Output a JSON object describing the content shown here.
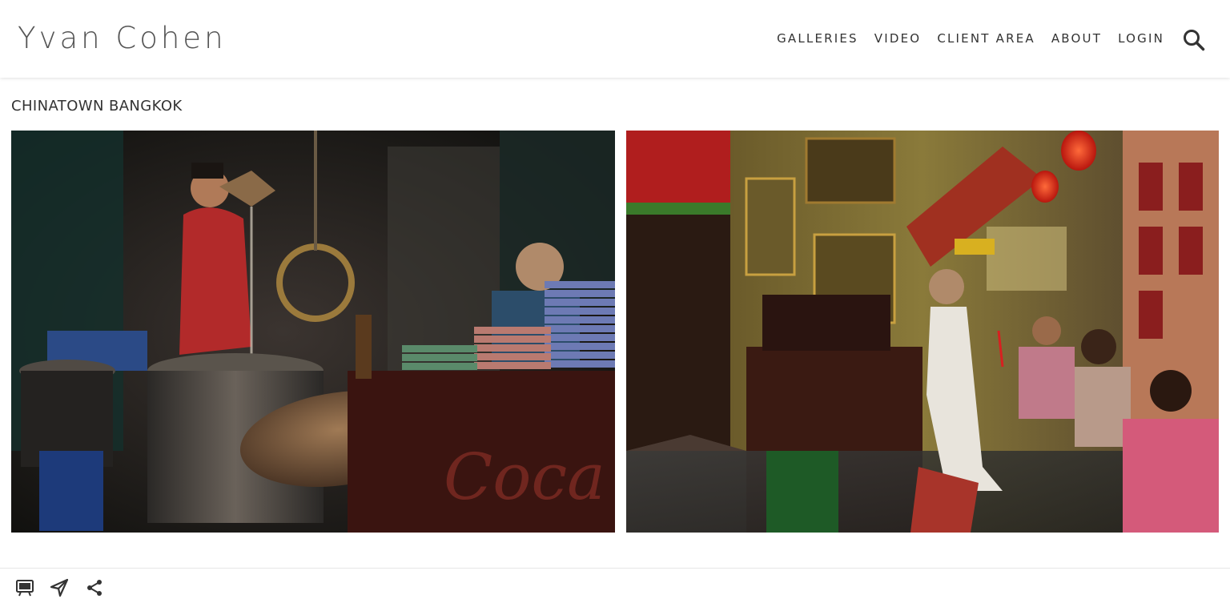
{
  "header": {
    "brand": "Yvan Cohen",
    "nav": [
      "GALLERIES",
      "VIDEO",
      "CLIENT AREA",
      "ABOUT",
      "LOGIN"
    ],
    "search_icon": "search-icon"
  },
  "gallery": {
    "title": "CHINATOWN BANGKOK",
    "photos": [
      {
        "subject": "street-food-vendor-photo"
      },
      {
        "subject": "temple-prayer-photo"
      }
    ]
  },
  "footer": {
    "icons": [
      "slideshow-icon",
      "send-icon",
      "share-icon"
    ]
  },
  "colors": {
    "text": "#333333",
    "brand": "#555555",
    "background": "#ffffff"
  }
}
